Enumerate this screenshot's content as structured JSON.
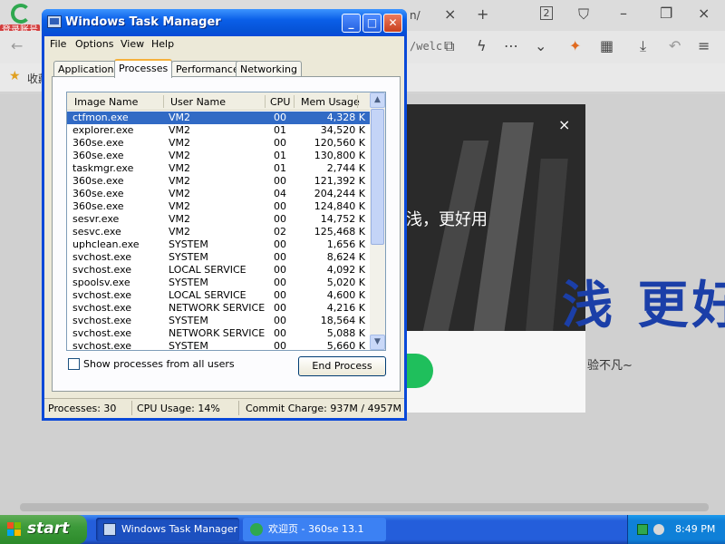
{
  "browser": {
    "login_badge": "登录账号",
    "tab_fragment": "n/",
    "tab_count": "2",
    "url_fragment": "/welc",
    "favorites_label": "收藏",
    "ad": {
      "slogan": "浅，更好用",
      "big_text": "浅 更好",
      "sub_text": "验不凡~",
      "close_glyph": "×"
    }
  },
  "task_manager": {
    "title": "Windows Task Manager",
    "menu": [
      "File",
      "Options",
      "View",
      "Help"
    ],
    "tabs": [
      {
        "label": "Applications",
        "active": false
      },
      {
        "label": "Processes",
        "active": true
      },
      {
        "label": "Performance",
        "active": false
      },
      {
        "label": "Networking",
        "active": false
      }
    ],
    "columns": {
      "image_name": "Image Name",
      "user_name": "User Name",
      "cpu": "CPU",
      "mem_usage": "Mem Usage"
    },
    "processes": [
      {
        "name": "ctfmon.exe",
        "user": "VM2",
        "cpu": "00",
        "mem": "4,328 K",
        "selected": true
      },
      {
        "name": "explorer.exe",
        "user": "VM2",
        "cpu": "01",
        "mem": "34,520 K"
      },
      {
        "name": "360se.exe",
        "user": "VM2",
        "cpu": "00",
        "mem": "120,560 K"
      },
      {
        "name": "360se.exe",
        "user": "VM2",
        "cpu": "01",
        "mem": "130,800 K"
      },
      {
        "name": "taskmgr.exe",
        "user": "VM2",
        "cpu": "01",
        "mem": "2,744 K"
      },
      {
        "name": "360se.exe",
        "user": "VM2",
        "cpu": "00",
        "mem": "121,392 K"
      },
      {
        "name": "360se.exe",
        "user": "VM2",
        "cpu": "04",
        "mem": "204,244 K"
      },
      {
        "name": "360se.exe",
        "user": "VM2",
        "cpu": "00",
        "mem": "124,840 K"
      },
      {
        "name": "sesvr.exe",
        "user": "VM2",
        "cpu": "00",
        "mem": "14,752 K"
      },
      {
        "name": "sesvc.exe",
        "user": "VM2",
        "cpu": "02",
        "mem": "125,468 K"
      },
      {
        "name": "uphclean.exe",
        "user": "SYSTEM",
        "cpu": "00",
        "mem": "1,656 K"
      },
      {
        "name": "svchost.exe",
        "user": "SYSTEM",
        "cpu": "00",
        "mem": "8,624 K"
      },
      {
        "name": "svchost.exe",
        "user": "LOCAL SERVICE",
        "cpu": "00",
        "mem": "4,092 K"
      },
      {
        "name": "spoolsv.exe",
        "user": "SYSTEM",
        "cpu": "00",
        "mem": "5,020 K"
      },
      {
        "name": "svchost.exe",
        "user": "LOCAL SERVICE",
        "cpu": "00",
        "mem": "4,600 K"
      },
      {
        "name": "svchost.exe",
        "user": "NETWORK SERVICE",
        "cpu": "00",
        "mem": "4,216 K"
      },
      {
        "name": "svchost.exe",
        "user": "SYSTEM",
        "cpu": "00",
        "mem": "18,564 K"
      },
      {
        "name": "svchost.exe",
        "user": "NETWORK SERVICE",
        "cpu": "00",
        "mem": "5,088 K"
      },
      {
        "name": "svchost.exe",
        "user": "SYSTEM",
        "cpu": "00",
        "mem": "5,660 K"
      }
    ],
    "show_all_users_label": "Show processes from all users",
    "show_all_users_checked": false,
    "end_process_label": "End Process",
    "status": {
      "processes": "Processes: 30",
      "cpu_usage": "CPU Usage: 14%",
      "commit_charge": "Commit Charge: 937M / 4957M"
    }
  },
  "taskbar": {
    "start_label": "start",
    "items": [
      {
        "label": "Windows Task Manager",
        "active": true
      },
      {
        "label": "欢迎页 - 360se 13.1",
        "active": false
      }
    ],
    "clock": "8:49 PM"
  },
  "colors": {
    "xp_blue": "#0a49d8",
    "selection": "#316ac5",
    "start_green": "#3c9a3a",
    "brand_blue": "#1b3fa8"
  }
}
